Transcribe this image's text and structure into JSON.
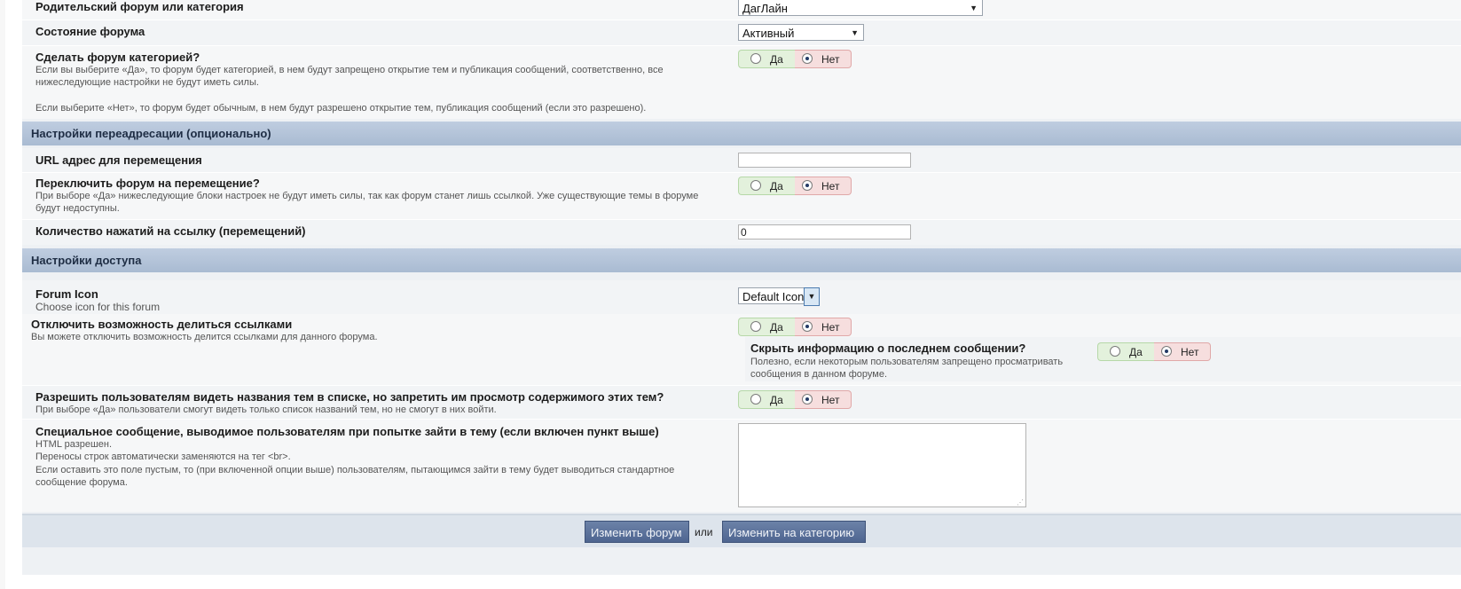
{
  "parent_forum": {
    "label": "Родительский форум или категория",
    "value": "ДагЛайн"
  },
  "forum_state": {
    "label": "Состояние форума",
    "value": "Активный"
  },
  "make_category": {
    "label": "Сделать форум категорией?",
    "desc_line1": "Если вы выберите «Да», то форум будет категорией, в нем будут запрещено открытие тем и публикация сообщений, соответственно, все",
    "desc_line2": "нижеследующие настройки не будут иметь силы.",
    "desc_line3": "Если выберите «Нет», то форум будет обычным, в нем будут разрешено открытие тем, публикация сообщений (если это разрешено).",
    "selected": "no"
  },
  "radio": {
    "yes": "Да",
    "no": "Нет"
  },
  "redirect_section": {
    "title": "Настройки переадресации (опционально)"
  },
  "redirect_url": {
    "label": "URL адрес для перемещения",
    "value": ""
  },
  "redirect_toggle": {
    "label": "Переключить форум на перемещение?",
    "desc_line1": "При выборе «Да» нижеследующие блоки настроек не будут иметь силы, так как форум станет лишь ссылкой. Уже существующие темы в форуме",
    "desc_line2": "будут недоступны.",
    "selected": "no"
  },
  "redirect_hits": {
    "label": "Количество нажатий на ссылку (перемещений)",
    "value": "0"
  },
  "access_section": {
    "title": "Настройки доступа"
  },
  "forum_icon": {
    "label": "Forum Icon",
    "desc": "Choose icon for this forum",
    "value": "Default Icon"
  },
  "disable_sharing": {
    "label": "Отключить возможность делиться ссылками",
    "desc": "Вы можете отключить возможность делится ссылками для данного форума.",
    "selected": "no"
  },
  "hide_last_post": {
    "label": "Скрыть информацию о последнем сообщении?",
    "desc_line1": "Полезно, если некоторым пользователям запрещено просматривать",
    "desc_line2": "сообщения в данном форуме.",
    "selected": "no"
  },
  "topic_titles_only": {
    "label": "Разрешить пользователям видеть названия тем в списке, но запретить им просмотр содержимого этих тем?",
    "desc": "При выборе «Да» пользователи смогут видеть только список названий тем, но не смогут в них войти.",
    "selected": "no"
  },
  "special_message": {
    "label": "Специальное сообщение, выводимое пользователям при попытке зайти в тему (если включен пункт выше)",
    "desc_line1": "HTML разрешен.",
    "desc_line2": "Переносы строк автоматически заменяются на тег <br>.",
    "desc_line3": "Если оставить это поле пустым, то (при включенной опции выше) пользователям, пытающимся зайти в тему будет выводиться стандартное",
    "desc_line4": "сообщение форума.",
    "value": ""
  },
  "footer": {
    "save_label": "Изменить форум",
    "or_label": "или",
    "category_label": "Изменить на категорию"
  }
}
